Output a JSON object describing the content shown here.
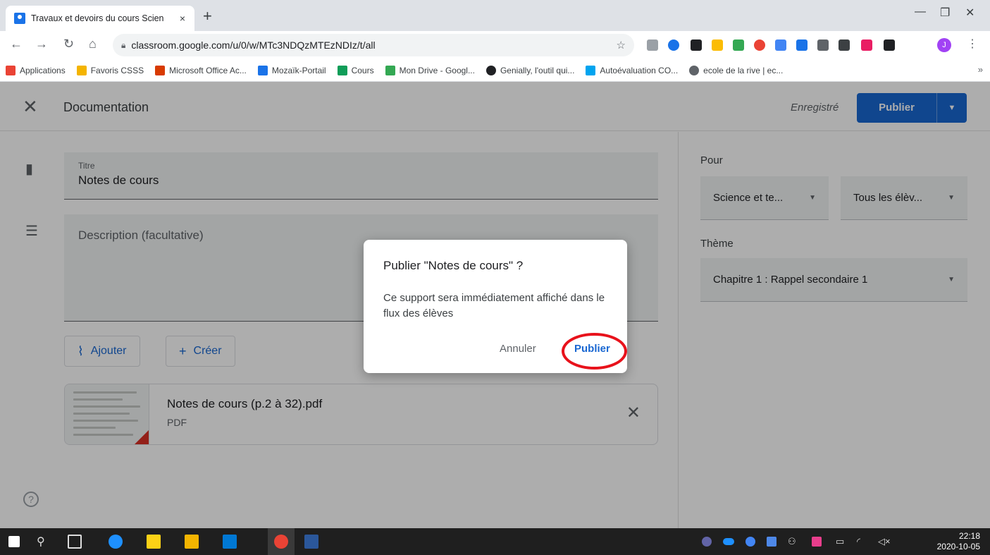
{
  "browser": {
    "tab_title": "Travaux et devoirs du cours Scien",
    "tab_close": "×",
    "new_tab": "+",
    "url": "classroom.google.com/u/0/w/MTc3NDQzMTEzNDIz/t/all",
    "avatar_letter": "J",
    "bookmarks": [
      {
        "label": "Applications",
        "color": "#ea4335"
      },
      {
        "label": "Favoris CSSS",
        "color": "#f4b400"
      },
      {
        "label": "Microsoft Office Ac...",
        "color": "#d83b01"
      },
      {
        "label": "Mozaïk-Portail",
        "color": "#1a73e8"
      },
      {
        "label": "Cours",
        "color": "#0f9d58"
      },
      {
        "label": "Mon Drive - Googl...",
        "color": "#34a853"
      },
      {
        "label": "Genially, l'outil qui...",
        "color": "#202124"
      },
      {
        "label": "Autoévaluation CO...",
        "color": "#00a4ef"
      },
      {
        "label": "ecole de la rive | ec...",
        "color": "#5f6368"
      }
    ],
    "bookmarks_more": "»"
  },
  "header": {
    "title": "Documentation",
    "saved_status": "Enregistré",
    "publish_label": "Publier"
  },
  "form": {
    "title_label": "Titre",
    "title_value": "Notes de cours",
    "description_placeholder": "Description (facultative)",
    "add_label": "Ajouter",
    "create_label": "Créer",
    "attachment": {
      "name": "Notes de cours (p.2 à 32).pdf",
      "type": "PDF"
    }
  },
  "right_panel": {
    "for_label": "Pour",
    "class_select": "Science et te...",
    "students_select": "Tous les élèv...",
    "topic_label": "Thème",
    "topic_select": "Chapitre 1 : Rappel secondaire 1"
  },
  "dialog": {
    "title": "Publier \"Notes de cours\" ?",
    "body": "Ce support sera immédiatement affiché dans le flux des élèves",
    "cancel": "Annuler",
    "confirm": "Publier"
  },
  "taskbar": {
    "time": "22:18",
    "date": "2020-10-05"
  },
  "colors": {
    "accent": "#1967d2",
    "highlight": "#e8121b"
  }
}
